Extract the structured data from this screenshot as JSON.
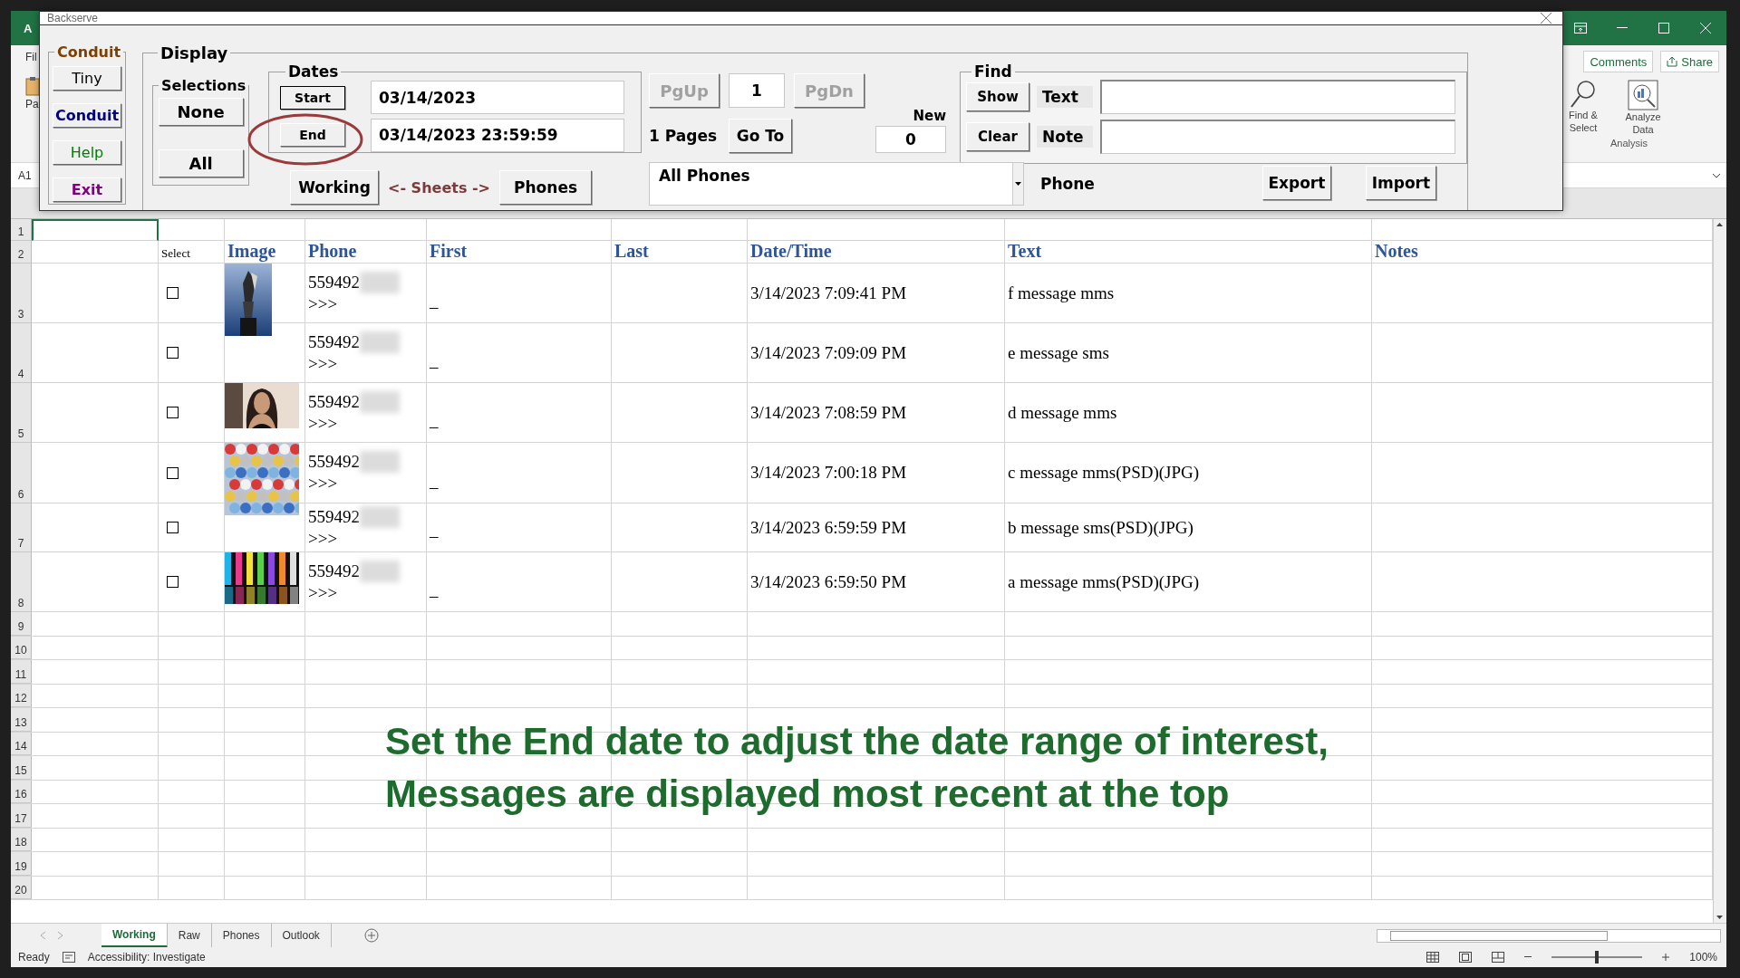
{
  "excel": {
    "autosave": "A",
    "menu": "Fil",
    "paste": "Pa",
    "name_box": "A1",
    "comments": "Comments",
    "share": "Share",
    "find_select": [
      "Find &",
      "Select"
    ],
    "analyze_data": [
      "Analyze",
      "Data"
    ],
    "group_label": "Analysis"
  },
  "dialog": {
    "title": "Backserve",
    "conduit": {
      "legend": "Conduit",
      "buttons": [
        {
          "label": "Tiny",
          "color": "#000000"
        },
        {
          "label": "Conduit",
          "color": "#000080"
        },
        {
          "label": "Help",
          "color": "#008000"
        },
        {
          "label": "Exit",
          "color": "#800080"
        }
      ]
    },
    "display": {
      "legend": "Display",
      "selections": {
        "legend": "Selections",
        "buttons": [
          "None",
          "All"
        ]
      },
      "dates": {
        "legend": "Dates",
        "start_button": "Start",
        "end_button": "End",
        "start_value": "03/14/2023",
        "end_value": "03/14/2023 23:59:59"
      },
      "sheets": {
        "left_button": "Working",
        "label": "<- Sheets ->",
        "right_button": "Phones"
      },
      "pager": {
        "prev": {
          "label": "PgUp",
          "disabled": true
        },
        "page": "1",
        "next": {
          "label": "PgDn",
          "disabled": true
        },
        "pages": "1 Pages",
        "go_to": "Go To",
        "new_label": "New",
        "new_value": "0"
      },
      "phone_select": {
        "value": "All Phones"
      },
      "find": {
        "legend": "Find",
        "show": "Show",
        "clear": "Clear",
        "text_label": "Text",
        "note_label": "Note"
      },
      "phone_label": "Phone",
      "export": "Export",
      "import": "Import"
    }
  },
  "sheet": {
    "row_headers": [
      "1",
      "2",
      "3",
      "4",
      "5",
      "6",
      "7",
      "8",
      "9",
      "10",
      "11",
      "12",
      "13",
      "14",
      "15",
      "16",
      "17",
      "18",
      "19",
      "20"
    ],
    "header": {
      "select": "Select",
      "columns": [
        "Image",
        "Phone",
        "First",
        "Last",
        "Date/Time",
        "Text",
        "Notes"
      ]
    },
    "rows": [
      {
        "checked": false,
        "phone": "559492",
        "phone_more": ">>>",
        "first": "_",
        "datetime": "3/14/2023 7:09:41 PM",
        "text": "f message mms"
      },
      {
        "checked": false,
        "phone": "559492",
        "phone_more": ">>>",
        "first": "_",
        "datetime": "3/14/2023 7:09:09 PM",
        "text": "e message sms"
      },
      {
        "checked": false,
        "phone": "559492",
        "phone_more": ">>>",
        "first": "_",
        "datetime": "3/14/2023 7:08:59 PM",
        "text": "d message mms"
      },
      {
        "checked": false,
        "phone": "559492",
        "phone_more": ">>>",
        "first": "_",
        "datetime": "3/14/2023 7:00:18 PM",
        "text": "c message mms(PSD)(JPG)"
      },
      {
        "checked": false,
        "phone": "559492",
        "phone_more": ">>>",
        "first": "_",
        "datetime": "3/14/2023 6:59:59 PM",
        "text": "b message sms(PSD)(JPG)"
      },
      {
        "checked": false,
        "phone": "559492",
        "phone_more": ">>>",
        "first": "_",
        "datetime": "3/14/2023 6:59:50 PM",
        "text": "a message mms(PSD)(JPG)"
      }
    ]
  },
  "annotation": [
    "Set the End date to adjust the date range of interest,",
    "Messages are displayed most recent at the top"
  ],
  "sheet_tabs": [
    {
      "label": "Working",
      "selected": true
    },
    {
      "label": "Raw",
      "selected": false
    },
    {
      "label": "Phones",
      "selected": false
    },
    {
      "label": "Outlook",
      "selected": false
    }
  ],
  "status_bar": {
    "ready": "Ready",
    "accessibility": "Accessibility: Investigate",
    "zoom": "100%",
    "zoom_slider": {
      "level": 0.5
    }
  }
}
